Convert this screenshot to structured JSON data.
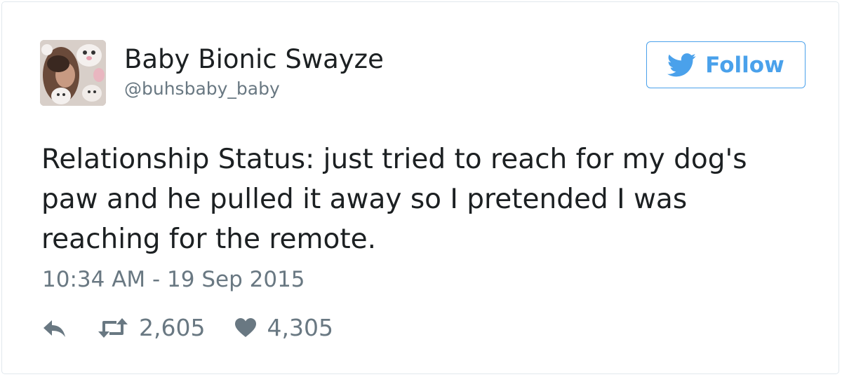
{
  "tweet": {
    "user": {
      "display_name": "Baby Bionic Swayze",
      "handle": "@buhsbaby_baby",
      "avatar_icon": "profile-photo-with-dogs"
    },
    "follow_button": {
      "label": "Follow",
      "icon": "twitter-bird-icon",
      "color": "#4aa1eb"
    },
    "text_lines": [
      "Relationship Status: just tried to reach for my dog's",
      "paw and he pulled it away so I pretended I was",
      "reaching for the remote."
    ],
    "timestamp": "10:34 AM - 19 Sep 2015",
    "actions": {
      "reply_icon": "reply-icon",
      "retweet_icon": "retweet-icon",
      "retweet_count": "2,605",
      "like_icon": "heart-icon",
      "like_count": "4,305"
    }
  }
}
